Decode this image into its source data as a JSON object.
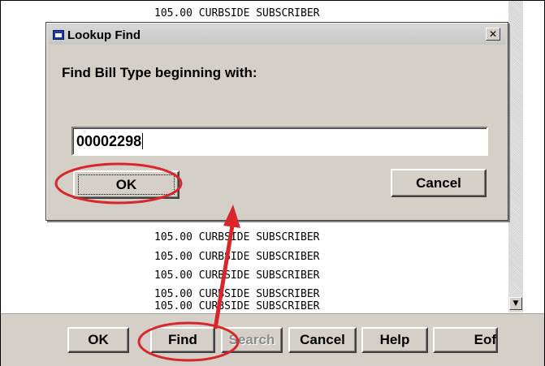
{
  "list": {
    "rows": [
      "105.00 CURBSIDE SUBSCRIBER",
      "105.00 CURBSIDE SUBSCRIBER",
      "105.00 CURBSIDE SUBSCRIBER",
      "105.00 CURBSIDE SUBSCRIBER",
      "105.00 CURBSIDE SUBSCRIBER",
      "105.00 CURBSIDE SUBSCRIBER",
      "105.00 CURBSIDE SUBSCRIBER"
    ]
  },
  "dialog": {
    "title": "Lookup Find",
    "close_label": "✕",
    "prompt": "Find Bill Type beginning with:",
    "input_value": "00002298",
    "ok_label": "OK",
    "cancel_label": "Cancel"
  },
  "bottom_bar": {
    "ok_label": "OK",
    "find_label": "Find",
    "search_label": "Search",
    "cancel_label": "Cancel",
    "help_label": "Help",
    "eof_label": "Eof"
  },
  "icons": {
    "window": "window-icon",
    "close": "close-icon",
    "scroll_down": "scroll-down-arrow-icon"
  },
  "annotation": {
    "highlight_color": "#d9262c"
  }
}
